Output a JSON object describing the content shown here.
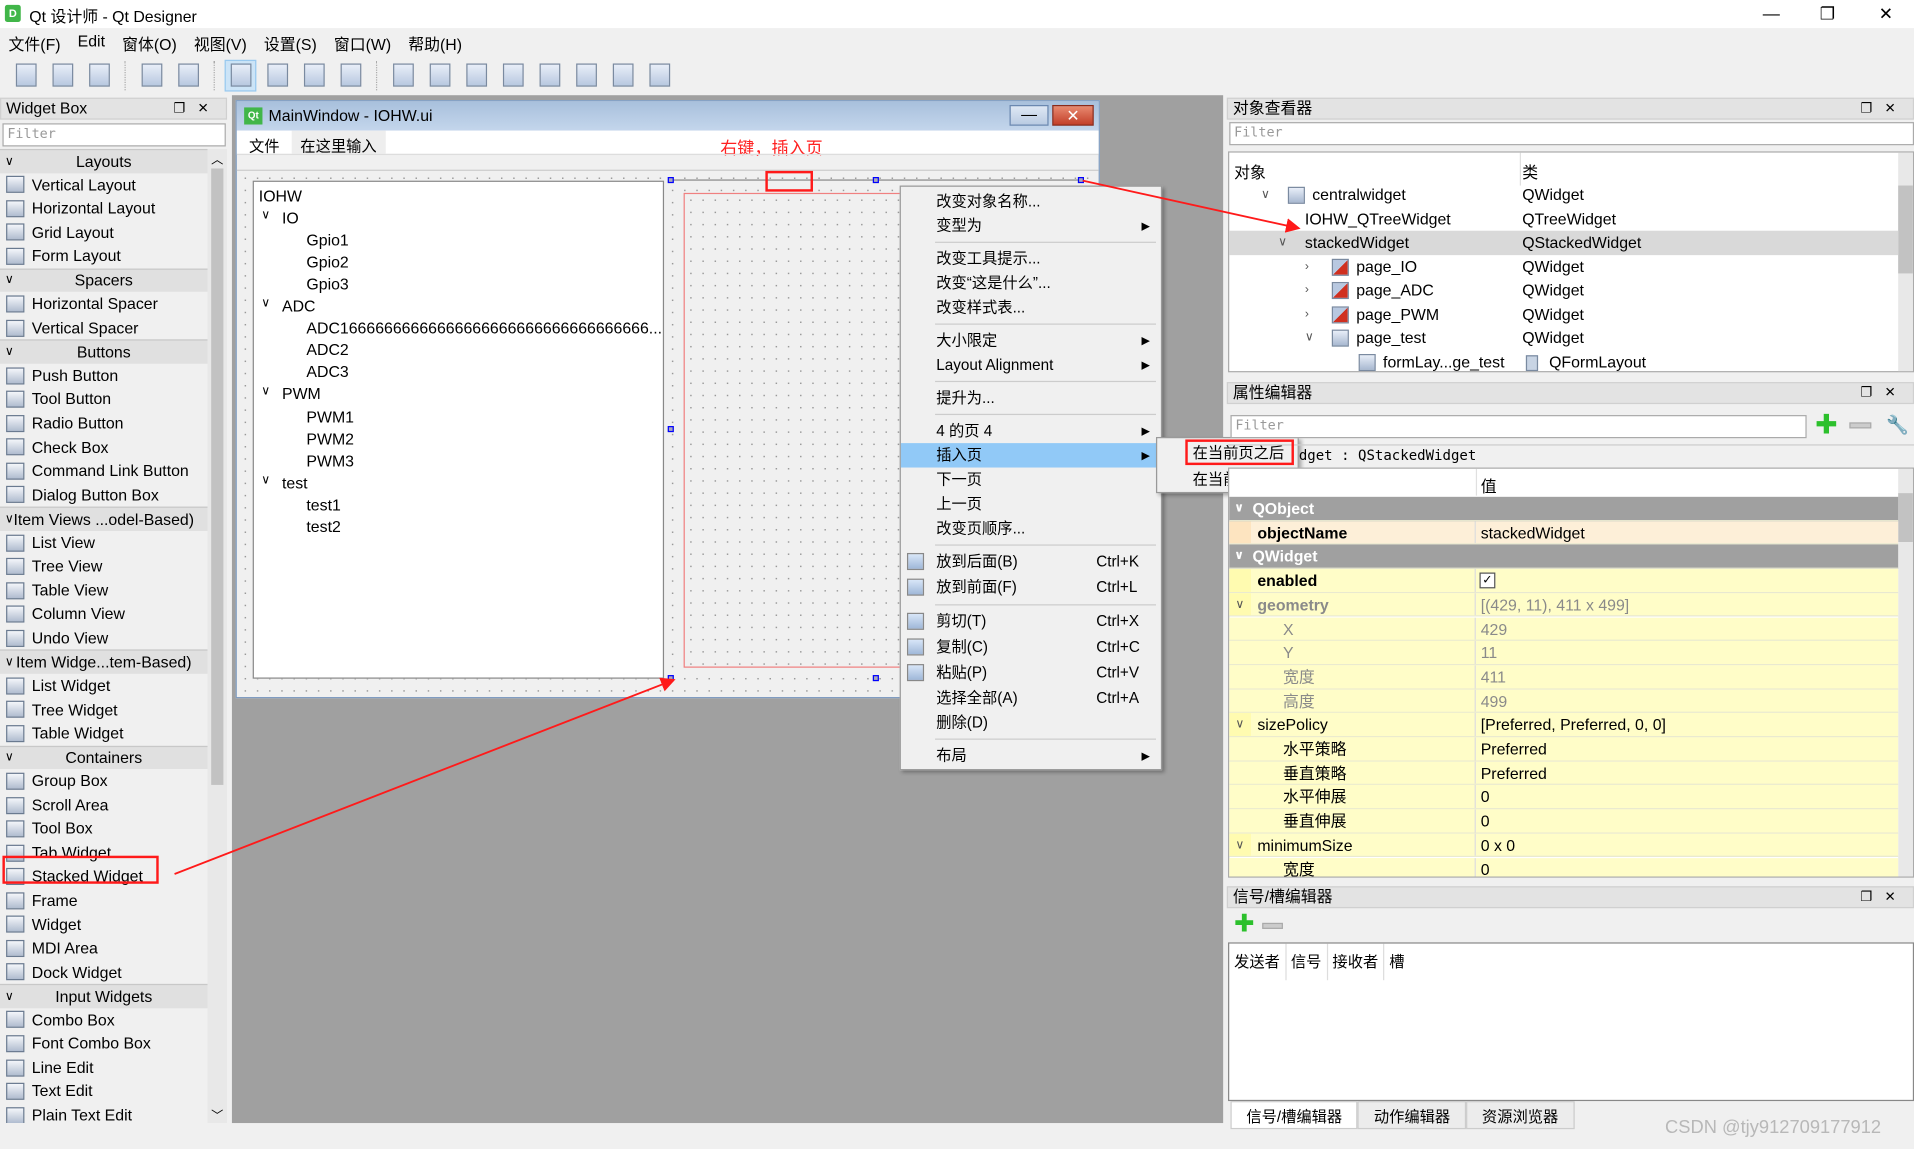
{
  "window": {
    "title": "Qt 设计师 - Qt Designer",
    "minimize": "—",
    "maximize": "❐",
    "close": "✕"
  },
  "menubar": [
    "文件(F)",
    "Edit",
    "窗体(O)",
    "视图(V)",
    "设置(S)",
    "窗口(W)",
    "帮助(H)"
  ],
  "toolbar": {
    "groups": [
      [
        "new-file",
        "open-file",
        "save-file"
      ],
      [
        "send-to-back",
        "bring-to-front"
      ],
      [
        "edit-widgets",
        "edit-signals-slots",
        "edit-buddies",
        "edit-tab-order"
      ],
      [
        "lay-out-horizontally",
        "lay-out-vertically",
        "lay-out-horizontal-splitter",
        "lay-out-vertical-splitter",
        "lay-out-grid",
        "lay-out-form",
        "break-layout",
        "adjust-size"
      ]
    ],
    "active": "edit-widgets"
  },
  "widget_box": {
    "title": "Widget Box",
    "filter_placeholder": "Filter",
    "items": [
      {
        "cat": "Layouts"
      },
      {
        "label": "Vertical Layout"
      },
      {
        "label": "Horizontal Layout"
      },
      {
        "label": "Grid Layout"
      },
      {
        "label": "Form Layout"
      },
      {
        "cat": "Spacers"
      },
      {
        "label": "Horizontal Spacer"
      },
      {
        "label": "Vertical Spacer"
      },
      {
        "cat": "Buttons"
      },
      {
        "label": "Push Button"
      },
      {
        "label": "Tool Button"
      },
      {
        "label": "Radio Button"
      },
      {
        "label": "Check Box"
      },
      {
        "label": "Command Link Button"
      },
      {
        "label": "Dialog Button Box"
      },
      {
        "cat": "Item Views ...odel-Based)"
      },
      {
        "label": "List View"
      },
      {
        "label": "Tree View"
      },
      {
        "label": "Table View"
      },
      {
        "label": "Column View"
      },
      {
        "label": "Undo View"
      },
      {
        "cat": "Item Widge...tem-Based)"
      },
      {
        "label": "List Widget"
      },
      {
        "label": "Tree Widget"
      },
      {
        "label": "Table Widget"
      },
      {
        "cat": "Containers"
      },
      {
        "label": "Group Box"
      },
      {
        "label": "Scroll Area"
      },
      {
        "label": "Tool Box"
      },
      {
        "label": "Tab Widget"
      },
      {
        "label": "Stacked Widget",
        "highlight": true
      },
      {
        "label": "Frame"
      },
      {
        "label": "Widget"
      },
      {
        "label": "MDI Area"
      },
      {
        "label": "Dock Widget"
      },
      {
        "cat": "Input Widgets"
      },
      {
        "label": "Combo Box"
      },
      {
        "label": "Font Combo Box"
      },
      {
        "label": "Line Edit"
      },
      {
        "label": "Text Edit"
      },
      {
        "label": "Plain Text Edit"
      }
    ]
  },
  "form": {
    "title": "MainWindow - IOHW.ui",
    "menu": [
      "文件",
      "在这里输入"
    ],
    "annotation": "右键，插入页",
    "tree": [
      {
        "t": "IOHW",
        "l": 0
      },
      {
        "t": "IO",
        "l": 0,
        "exp": true
      },
      {
        "t": "Gpio1",
        "l": 1
      },
      {
        "t": "Gpio2",
        "l": 1
      },
      {
        "t": "Gpio3",
        "l": 1
      },
      {
        "t": "ADC",
        "l": 0,
        "exp": true
      },
      {
        "t": "ADC16666666666666666666666666666666666...",
        "l": 1
      },
      {
        "t": "ADC2",
        "l": 1
      },
      {
        "t": "ADC3",
        "l": 1
      },
      {
        "t": "PWM",
        "l": 0,
        "exp": true
      },
      {
        "t": "PWM1",
        "l": 1
      },
      {
        "t": "PWM2",
        "l": 1
      },
      {
        "t": "PWM3",
        "l": 1
      },
      {
        "t": "test",
        "l": 0,
        "exp": true
      },
      {
        "t": "test1",
        "l": 1
      },
      {
        "t": "test2",
        "l": 1
      }
    ]
  },
  "context_menu": [
    {
      "label": "改变对象名称..."
    },
    {
      "label": "变型为",
      "sub": true
    },
    {
      "sep": true
    },
    {
      "label": "改变工具提示..."
    },
    {
      "label": "改变“这是什么”..."
    },
    {
      "label": "改变样式表..."
    },
    {
      "sep": true
    },
    {
      "label": "大小限定",
      "sub": true
    },
    {
      "label": "Layout Alignment",
      "sub": true
    },
    {
      "sep": true
    },
    {
      "label": "提升为..."
    },
    {
      "sep": true
    },
    {
      "label": "4 的页 4",
      "sub": true
    },
    {
      "label": "插入页",
      "sub": true,
      "hl": true
    },
    {
      "label": "下一页"
    },
    {
      "label": "上一页"
    },
    {
      "label": "改变页顺序..."
    },
    {
      "sep": true
    },
    {
      "label": "放到后面(B)",
      "sc": "Ctrl+K",
      "icon": "send-to-back"
    },
    {
      "label": "放到前面(F)",
      "sc": "Ctrl+L",
      "icon": "bring-to-front"
    },
    {
      "sep": true
    },
    {
      "label": "剪切(T)",
      "sc": "Ctrl+X",
      "icon": "scissors"
    },
    {
      "label": "复制(C)",
      "sc": "Ctrl+C",
      "icon": "copy"
    },
    {
      "label": "粘贴(P)",
      "sc": "Ctrl+V",
      "icon": "paste"
    },
    {
      "label": "选择全部(A)",
      "sc": "Ctrl+A"
    },
    {
      "label": "删除(D)"
    },
    {
      "sep": true
    },
    {
      "label": "布局",
      "sub": true
    }
  ],
  "submenu": [
    "在当前页之后",
    "在当前页之前"
  ],
  "object_inspector": {
    "title": "对象查看器",
    "filter_placeholder": "Filter",
    "col_object": "对象",
    "col_class": "类",
    "rows": [
      {
        "o": "centralwidget",
        "c": "QWidget",
        "l": 0,
        "exp": "v",
        "icon": "horizontal-layout"
      },
      {
        "o": "IOHW_QTreeWidget",
        "c": "QTreeWidget",
        "l": 1
      },
      {
        "o": "stackedWidget",
        "c": "QStackedWidget",
        "l": 1,
        "exp": "v",
        "sel": true
      },
      {
        "o": "page_IO",
        "c": "QWidget",
        "l": 2,
        "exp": ">",
        "icon": "broken-layout"
      },
      {
        "o": "page_ADC",
        "c": "QWidget",
        "l": 2,
        "exp": ">",
        "icon": "broken-layout"
      },
      {
        "o": "page_PWM",
        "c": "QWidget",
        "l": 2,
        "exp": ">",
        "icon": "broken-layout"
      },
      {
        "o": "page_test",
        "c": "QWidget",
        "l": 2,
        "exp": "v",
        "icon": "vertical-layout"
      },
      {
        "o": "formLay...ge_test",
        "c": "QFormLayout",
        "l": 3,
        "icon": "form-layout"
      }
    ]
  },
  "property_editor": {
    "title": "属性编辑器",
    "filter_placeholder": "Filter",
    "class_line": "dget : QStackedWidget",
    "col_value": "值",
    "rows": [
      {
        "g": "QObject"
      },
      {
        "n": "objectName",
        "v": "stackedWidget",
        "bold": true,
        "peach": true
      },
      {
        "g": "QWidget"
      },
      {
        "n": "enabled",
        "check": true,
        "bold": true
      },
      {
        "n": "geometry",
        "v": "[(429, 11), 411 x 499]",
        "exp": true,
        "dim": true,
        "bold": true
      },
      {
        "n": "X",
        "v": "429",
        "sub": true,
        "dim": true
      },
      {
        "n": "Y",
        "v": "11",
        "sub": true,
        "dim": true
      },
      {
        "n": "宽度",
        "v": "411",
        "sub": true,
        "dim": true
      },
      {
        "n": "高度",
        "v": "499",
        "sub": true,
        "dim": true
      },
      {
        "n": "sizePolicy",
        "v": "[Preferred, Preferred, 0, 0]",
        "exp": true
      },
      {
        "n": "水平策略",
        "v": "Preferred",
        "sub": true
      },
      {
        "n": "垂直策略",
        "v": "Preferred",
        "sub": true
      },
      {
        "n": "水平伸展",
        "v": "0",
        "sub": true
      },
      {
        "n": "垂直伸展",
        "v": "0",
        "sub": true
      },
      {
        "n": "minimumSize",
        "v": "0 x 0",
        "exp": true
      },
      {
        "n": "宽度",
        "v": "0",
        "sub": true
      }
    ]
  },
  "signal_slot_editor": {
    "title": "信号/槽编辑器",
    "columns": [
      "发送者",
      "信号",
      "接收者",
      "槽"
    ]
  },
  "bottom_tabs": [
    "信号/槽编辑器",
    "动作编辑器",
    "资源浏览器"
  ],
  "watermark": "CSDN @tjy912709177912",
  "colors": {
    "annotation": "#ff1a1a",
    "menu_highlight": "#91c9f7",
    "property_yellow": "#fffdc8",
    "property_peach": "#fdefd8",
    "group_gray": "#a0a0a0",
    "mdi_gray": "#a0a0a0"
  }
}
